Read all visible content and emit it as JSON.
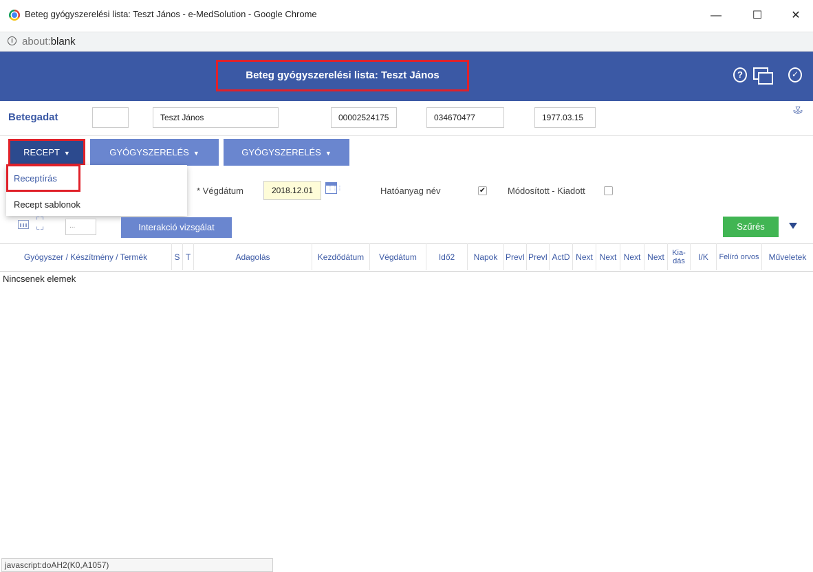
{
  "window": {
    "title": "Beteg gyógyszerelési lista: Teszt János - e-MedSolution - Google Chrome",
    "minimize": "—",
    "maximize": "☐",
    "close": "✕"
  },
  "address": {
    "scheme": "about:",
    "rest": "blank"
  },
  "header": {
    "title": "Beteg gyógyszerelési lista: Teszt János",
    "help_icon": "?",
    "check_icon": "✓"
  },
  "patient": {
    "label": "Betegadat",
    "field0": "",
    "name": "Teszt János",
    "id1": "00002524175",
    "id2": "034670477",
    "birthdate": "1977.03.15"
  },
  "toolbar": {
    "recept": "RECEPT",
    "gyogyszereles1": "GYÓGYSZERELÉS",
    "gyogyszereles2": "GYÓGYSZERELÉS",
    "caret": "▼"
  },
  "dropdown": {
    "items": [
      "Receptírás",
      "Recept sablonok"
    ]
  },
  "filters": {
    "vegdatum_label": "* Végdátum",
    "vegdatum_value": "2018.12.01",
    "hatoanyag_label": "Hatóanyag név",
    "hatoanyag_checked": "✔",
    "modositott_label": "Módosított - Kiadott",
    "modositott_checked": ""
  },
  "tools": {
    "small_input": "...",
    "interakcio": "Interakció vizsgálat",
    "szures": "Szűrés"
  },
  "table": {
    "columns": [
      "Gyógyszer / Készítmény / Termék",
      "S",
      "T",
      "Adagolás",
      "Kezdődátum",
      "Végdátum",
      "Idő2",
      "Napok",
      "PrevI",
      "PrevI",
      "ActD",
      "Next",
      "Next",
      "Next",
      "Next",
      "Kia- dás",
      "I/K",
      "Felíró orvos",
      "Műveletek"
    ],
    "empty": "Nincsenek elemek"
  },
  "status": "javascript:doAH2(K0,A1057)",
  "colors": {
    "header": "#3b59a5",
    "button": "#6a86cf",
    "button_dark": "#2c4a8e",
    "success": "#41b553",
    "highlight": "#e0212a"
  }
}
